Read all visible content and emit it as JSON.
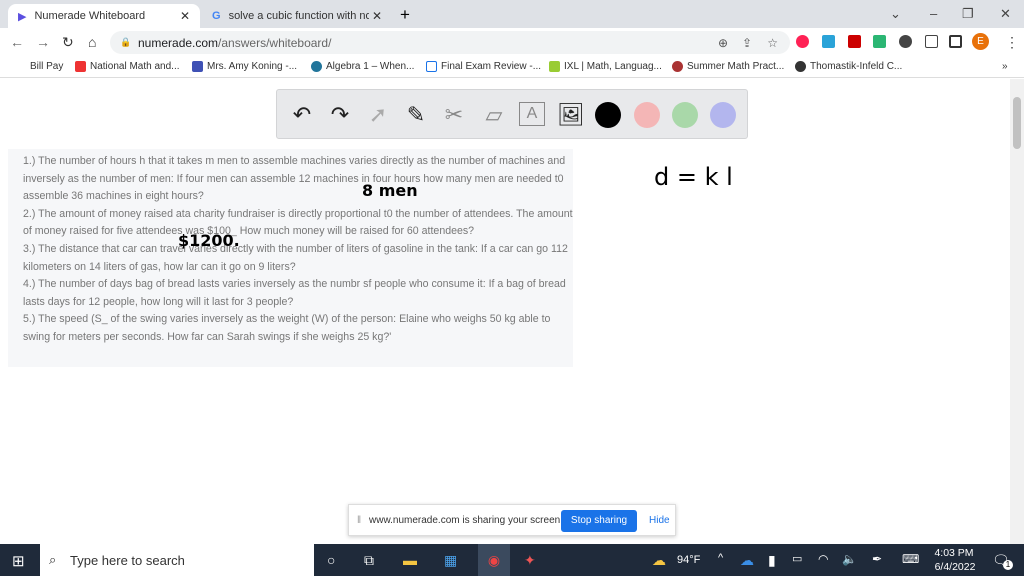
{
  "browser": {
    "tabs": [
      {
        "title": "Numerade Whiteboard"
      },
      {
        "title": "solve a cubic function with no lin"
      }
    ],
    "url_host": "numerade.com",
    "url_path": "/answers/whiteboard/",
    "profile_initial": "E"
  },
  "bookmarks": [
    {
      "label": "Bill Pay"
    },
    {
      "label": "National Math and..."
    },
    {
      "label": "Mrs. Amy Koning -..."
    },
    {
      "label": "Algebra 1 – When..."
    },
    {
      "label": "Final Exam Review -..."
    },
    {
      "label": "IXL | Math, Languag..."
    },
    {
      "label": "Summer Math Pract..."
    },
    {
      "label": "Thomastik-Infeld C..."
    }
  ],
  "whiteboard": {
    "colors": [
      "#000000",
      "#f4b6b6",
      "#a9d8a9",
      "#b3b6ee"
    ],
    "questions": [
      "1.) The number of hours h that it takes m men to assemble machines varies directly as the number of machines and inversely as the number of men: If four men can assemble 12 machines in four hours how many men are needed t0 assemble 36 machines in eight hours?",
      "2.) The amount of money raised ata charity fundraiser is directly proportional t0 the number of attendees. The amount of money raised for five attendees was $100_ How much money will be raised for 60 attendees?",
      "3.) The distance that car can travel varies directly with the number of liters of gasoline in the tank: If a car can go 112 kilometers on 14 liters of gas, how lar can it go on 9 liters?",
      "4.) The number of days bag of bread lasts varies inversely as the numbr sf people who consume it: If a bag of bread lasts days for 12 people, how long will it last for 3 people?",
      "5.) The speed (S_ of the swing varies inversely as the weight (W) of the person: Elaine who weighs 50 kg able to swing for meters per seconds. How far can Sarah swings if she weighs 25 kg?'"
    ],
    "handwriting": {
      "answer1": "8 men",
      "answer2": "$1200.",
      "formula": "d = k l"
    }
  },
  "share_bar": {
    "message": "www.numerade.com is sharing your screen.",
    "stop": "Stop sharing",
    "hide": "Hide"
  },
  "taskbar": {
    "search_placeholder": "Type here to search",
    "weather": "94°F",
    "time": "4:03 PM",
    "date": "6/4/2022",
    "notifications": "1"
  }
}
